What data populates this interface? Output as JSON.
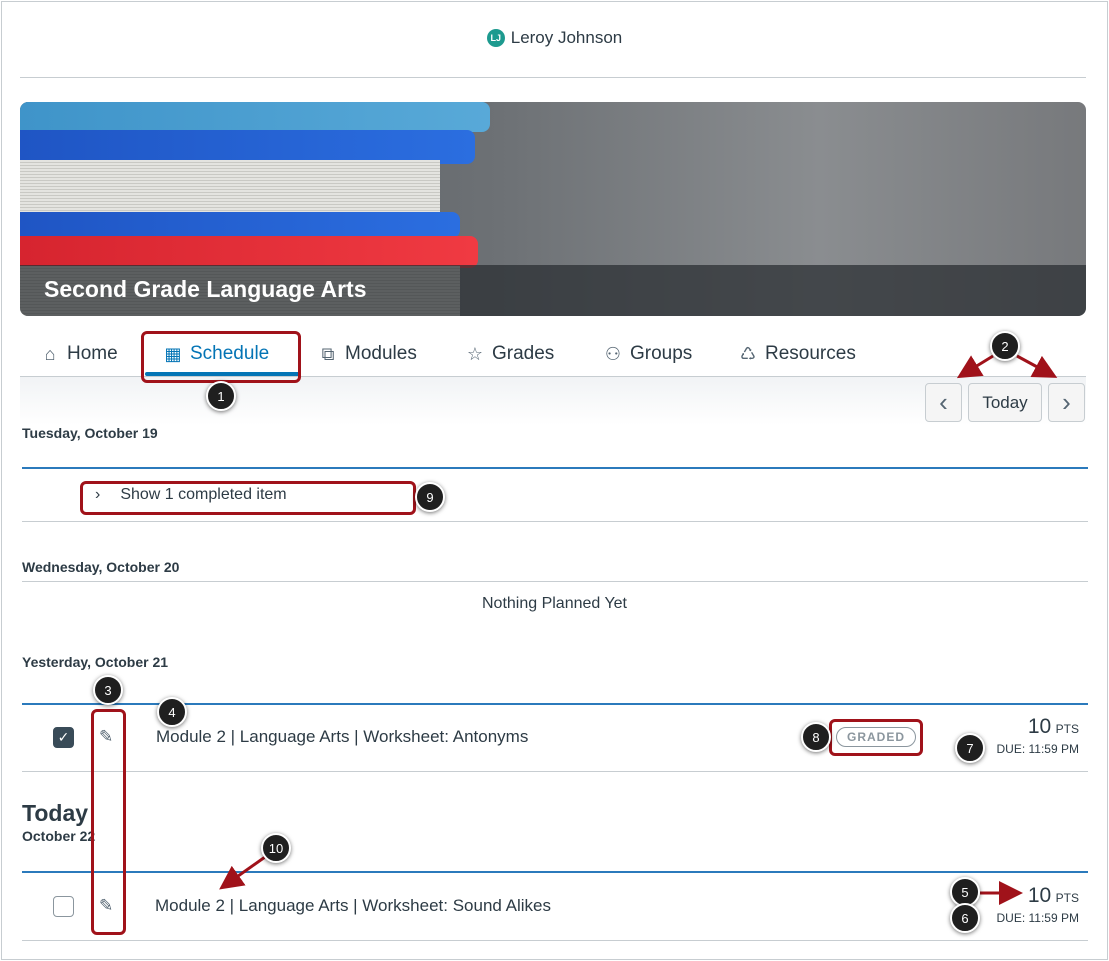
{
  "header": {
    "avatar_initials": "LJ",
    "user_name": "Leroy Johnson"
  },
  "course": {
    "title": "Second Grade Language Arts"
  },
  "tabs": [
    {
      "label": "Home",
      "icon": "home-icon"
    },
    {
      "label": "Schedule",
      "icon": "calendar-icon",
      "active": true
    },
    {
      "label": "Modules",
      "icon": "modules-icon"
    },
    {
      "label": "Grades",
      "icon": "star-icon"
    },
    {
      "label": "Groups",
      "icon": "groups-icon"
    },
    {
      "label": "Resources",
      "icon": "resources-icon"
    }
  ],
  "nav": {
    "today_label": "Today"
  },
  "days": [
    {
      "label": "Tuesday, October 19",
      "completed_label": "Show 1 completed item"
    },
    {
      "label": "Wednesday, October 20",
      "empty_label": "Nothing Planned Yet"
    },
    {
      "label": "Yesterday, October 21",
      "item": {
        "title": "Module 2 | Language Arts | Worksheet: Antonyms",
        "badge": "GRADED",
        "points": "10",
        "points_unit": "PTS",
        "due": "DUE: 11:59 PM",
        "checked": true
      }
    },
    {
      "label": "Today",
      "sublabel": "October 22",
      "item": {
        "title": "Module 2 | Language Arts | Worksheet: Sound Alikes",
        "points": "10",
        "points_unit": "PTS",
        "due": "DUE: 11:59 PM",
        "checked": false
      }
    }
  ],
  "annotations": [
    "1",
    "2",
    "3",
    "4",
    "5",
    "6",
    "7",
    "8",
    "9",
    "10"
  ],
  "colors": {
    "accent": "#0374b5",
    "annotation": "#a0121a",
    "day_divider": "#2b7abc"
  }
}
